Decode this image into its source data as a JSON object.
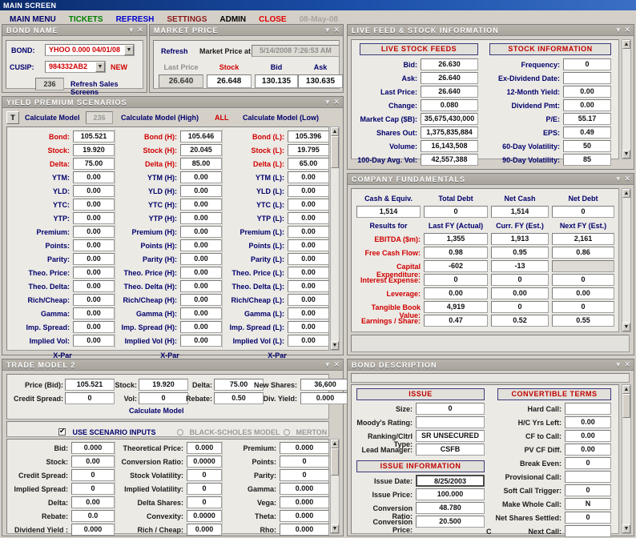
{
  "window": {
    "title": "MAIN SCREEN",
    "minimize": "▾",
    "close": "✕"
  },
  "menubar": {
    "items": [
      {
        "label": "MAIN MENU",
        "color": "#00006b"
      },
      {
        "label": "TICKETS",
        "color": "#008000"
      },
      {
        "label": "REFRESH",
        "color": "#0000cc"
      },
      {
        "label": "SETTINGS",
        "color": "#8b1a1a"
      },
      {
        "label": "ADMIN",
        "color": "#000000"
      },
      {
        "label": "CLOSE",
        "color": "#e00000"
      }
    ],
    "date": "08-May-08"
  },
  "bond_name": {
    "title": "BOND NAME",
    "bond_label": "BOND:",
    "bond_value": "YHOO 0.000 04/01/08",
    "cusip_label": "CUSIP:",
    "cusip_value": "984332AB2",
    "new_button": "NEW",
    "count_button": "236",
    "refresh_sales": "Refresh Sales Screens"
  },
  "market_price": {
    "title": "MARKET PRICE",
    "refresh": "Refresh",
    "at_label": "Market Price at",
    "timestamp": "5/14/2008 7:26:53 AM",
    "columns": [
      {
        "label": "Last Price",
        "value": "26.640",
        "style": "gray"
      },
      {
        "label": "Stock",
        "value": "26.648",
        "style": "red"
      },
      {
        "label": "Bid",
        "value": "130.135",
        "style": "blue"
      },
      {
        "label": "Ask",
        "value": "130.635",
        "style": "blue"
      }
    ]
  },
  "yield_premium": {
    "title": "YIELD PREMIUM SCENARIOS",
    "toolbar": {
      "t_button": "T",
      "calc_model": "Calculate Model",
      "count": "236",
      "calc_high": "Calculate Model (High)",
      "all": "ALL",
      "calc_low": "Calculate Model (Low)"
    },
    "columns": [
      {
        "xpar": "X-Par",
        "rows": [
          {
            "label": "Bond:",
            "value": "105.521",
            "red": true
          },
          {
            "label": "Stock:",
            "value": "19.920",
            "red": true
          },
          {
            "label": "Delta:",
            "value": "75.00",
            "red": true
          },
          {
            "label": "YTM:",
            "value": "0.00",
            "red": false
          },
          {
            "label": "YLD:",
            "value": "0.00",
            "red": false
          },
          {
            "label": "YTC:",
            "value": "0.00",
            "red": false
          },
          {
            "label": "YTP:",
            "value": "0.00",
            "red": false
          },
          {
            "label": "Premium:",
            "value": "0.00",
            "red": false
          },
          {
            "label": "Points:",
            "value": "0.00",
            "red": false
          },
          {
            "label": "Parity:",
            "value": "0.00",
            "red": false
          },
          {
            "label": "Theo. Price:",
            "value": "0.00",
            "red": false
          },
          {
            "label": "Theo. Delta:",
            "value": "0.00",
            "red": false
          },
          {
            "label": "Rich/Cheap:",
            "value": "0.00",
            "red": false
          },
          {
            "label": "Gamma:",
            "value": "0.00",
            "red": false
          },
          {
            "label": "Imp. Spread:",
            "value": "0.00",
            "red": false
          },
          {
            "label": "Implied Vol:",
            "value": "0.00",
            "red": false
          }
        ]
      },
      {
        "xpar": "X-Par",
        "rows": [
          {
            "label": "Bond (H):",
            "value": "105.646",
            "red": true
          },
          {
            "label": "Stock (H):",
            "value": "20.045",
            "red": true
          },
          {
            "label": "Delta (H):",
            "value": "85.00",
            "red": true
          },
          {
            "label": "YTM (H):",
            "value": "0.00",
            "red": false
          },
          {
            "label": "YLD (H):",
            "value": "0.00",
            "red": false
          },
          {
            "label": "YTC (H):",
            "value": "0.00",
            "red": false
          },
          {
            "label": "YTP (H):",
            "value": "0.00",
            "red": false
          },
          {
            "label": "Premium (H):",
            "value": "0.00",
            "red": false
          },
          {
            "label": "Points (H):",
            "value": "0.00",
            "red": false
          },
          {
            "label": "Parity (H):",
            "value": "0.00",
            "red": false
          },
          {
            "label": "Theo. Price (H):",
            "value": "0.00",
            "red": false
          },
          {
            "label": "Theo. Delta (H):",
            "value": "0.00",
            "red": false
          },
          {
            "label": "Rich/Cheap (H):",
            "value": "0.00",
            "red": false
          },
          {
            "label": "Gamma (H):",
            "value": "0.00",
            "red": false
          },
          {
            "label": "Imp. Spread (H):",
            "value": "0.00",
            "red": false
          },
          {
            "label": "Implied Vol (H):",
            "value": "0.00",
            "red": false
          }
        ]
      },
      {
        "xpar": "X-Par",
        "rows": [
          {
            "label": "Bond (L):",
            "value": "105.396",
            "red": true
          },
          {
            "label": "Stock (L):",
            "value": "19.795",
            "red": true
          },
          {
            "label": "Delta (L):",
            "value": "65.00",
            "red": true
          },
          {
            "label": "YTM (L):",
            "value": "0.00",
            "red": false
          },
          {
            "label": "YLD (L):",
            "value": "0.00",
            "red": false
          },
          {
            "label": "YTC (L):",
            "value": "0.00",
            "red": false
          },
          {
            "label": "YTP (L):",
            "value": "0.00",
            "red": false
          },
          {
            "label": "Premium (L):",
            "value": "0.00",
            "red": false
          },
          {
            "label": "Points (L):",
            "value": "0.00",
            "red": false
          },
          {
            "label": "Parity (L):",
            "value": "0.00",
            "red": false
          },
          {
            "label": "Theo. Price (L):",
            "value": "0.00",
            "red": false
          },
          {
            "label": "Theo. Delta (L):",
            "value": "0.00",
            "red": false
          },
          {
            "label": "Rich/Cheap (L):",
            "value": "0.00",
            "red": false
          },
          {
            "label": "Gamma (L):",
            "value": "0.00",
            "red": false
          },
          {
            "label": "Imp. Spread (L):",
            "value": "0.00",
            "red": false
          },
          {
            "label": "Implied Vol (L):",
            "value": "0.00",
            "red": false
          }
        ]
      }
    ]
  },
  "trade_model": {
    "title": "TRADE MODEL 2",
    "inputs_row1": [
      {
        "label": "Price (Bid):",
        "value": "105.521"
      },
      {
        "label": "Stock:",
        "value": "19.920"
      },
      {
        "label": "Delta:",
        "value": "75.00"
      },
      {
        "label": "New Shares:",
        "value": "36,600"
      }
    ],
    "inputs_row2": [
      {
        "label": "Credit Spread:",
        "value": "0"
      },
      {
        "label": "Vol:",
        "value": "0"
      },
      {
        "label": "Rebate:",
        "value": "0.50"
      },
      {
        "label": "Div. Yield:",
        "value": "0.000"
      }
    ],
    "calculate": "Calculate Model",
    "use_scenario_inputs": "USE SCENARIO INPUTS",
    "black_scholes": "BLACK-SCHOLES MODEL",
    "merton": "MERTON MODEL",
    "results": [
      {
        "rows": [
          {
            "label": "Bid:",
            "value": "0.000"
          },
          {
            "label": "Stock:",
            "value": "0.00"
          },
          {
            "label": "Credit Spread:",
            "value": "0"
          },
          {
            "label": "Implied Spread:",
            "value": "0"
          },
          {
            "label": "Delta:",
            "value": "0.00"
          },
          {
            "label": "Rebate:",
            "value": "0.0"
          },
          {
            "label": "Dividend Yield :",
            "value": "0.000"
          }
        ]
      },
      {
        "rows": [
          {
            "label": "Theoretical Price:",
            "value": "0.000"
          },
          {
            "label": "Conversion Ratio:",
            "value": "0.0000"
          },
          {
            "label": "Stock Volatility:",
            "value": "0"
          },
          {
            "label": "Implied Volatility:",
            "value": "0"
          },
          {
            "label": "Delta Shares:",
            "value": "0"
          },
          {
            "label": "Convexity:",
            "value": "0.0000"
          },
          {
            "label": "Rich / Cheap:",
            "value": "0.000"
          }
        ]
      },
      {
        "rows": [
          {
            "label": "Premium:",
            "value": "0.000"
          },
          {
            "label": "Points:",
            "value": "0"
          },
          {
            "label": "Parity:",
            "value": "0"
          },
          {
            "label": "Gamma:",
            "value": "0.000"
          },
          {
            "label": "Vega:",
            "value": "0.000"
          },
          {
            "label": "Theta:",
            "value": "0.000"
          },
          {
            "label": "Rho:",
            "value": "0.000"
          }
        ]
      }
    ]
  },
  "live_feed": {
    "title": "LIVE FEED & STOCK INFORMATION",
    "left_header": "LIVE STOCK FEEDS",
    "right_header": "STOCK INFORMATION",
    "left_rows": [
      {
        "label": "Bid:",
        "value": "26.630"
      },
      {
        "label": "Ask:",
        "value": "26.640"
      },
      {
        "label": "Last Price:",
        "value": "26.640"
      },
      {
        "label": "Change:",
        "value": "0.080"
      },
      {
        "label": "Market Cap ($B):",
        "value": "35,675,430,000"
      },
      {
        "label": "Shares Out:",
        "value": "1,375,835,884"
      },
      {
        "label": "Volume:",
        "value": "16,143,508"
      },
      {
        "label": "100-Day Avg. Vol:",
        "value": "42,557,388"
      }
    ],
    "right_rows": [
      {
        "label": "Frequency:",
        "value": "0"
      },
      {
        "label": "Ex-Dividend Date:",
        "value": ""
      },
      {
        "label": "12-Month Yield:",
        "value": "0.00"
      },
      {
        "label": "Dividend Pmt:",
        "value": "0.00"
      },
      {
        "label": "P/E:",
        "value": "55.17"
      },
      {
        "label": "EPS:",
        "value": "0.49"
      },
      {
        "label": "60-Day Volatility:",
        "value": "50"
      },
      {
        "label": "90-Day Volatility:",
        "value": "85"
      }
    ]
  },
  "fundamentals": {
    "title": "COMPANY FUNDAMENTALS",
    "cash_headers": [
      "Cash & Equiv.",
      "Total Debt",
      "Net Cash",
      "Net Debt"
    ],
    "cash_values": [
      "1,514",
      "0",
      "1,514",
      "0"
    ],
    "results_label": "Results for",
    "period_headers": [
      "Last FY (Actual)",
      "Curr. FY (Est.)",
      "Next FY (Est.)"
    ],
    "rows": [
      {
        "label": "EBITDA ($m):",
        "red": true,
        "values": [
          "1,355",
          "1,913",
          "2,161"
        ]
      },
      {
        "label": "Free Cash Flow:",
        "red": true,
        "values": [
          "0.98",
          "0.95",
          "0.86"
        ]
      },
      {
        "label": "Capital Expenditure:",
        "red": true,
        "values": [
          "-602",
          "-13",
          ""
        ]
      },
      {
        "label": "Interest Expense:",
        "red": true,
        "values": [
          "0",
          "0",
          "0"
        ]
      },
      {
        "label": "Leverage:",
        "red": true,
        "values": [
          "0.00",
          "0.00",
          "0.00"
        ]
      },
      {
        "label": "Tangible Book Value:",
        "red": true,
        "values": [
          "4,919",
          "0",
          "0"
        ]
      },
      {
        "label": "Earnings / Share:",
        "red": true,
        "values": [
          "0.47",
          "0.52",
          "0.55"
        ]
      }
    ]
  },
  "bond_description": {
    "title": "BOND DESCRIPTION",
    "issue_header": "ISSUE",
    "convertible_header": "CONVERTIBLE TERMS",
    "issue_info_header": "ISSUE INFORMATION",
    "issue_rows": [
      {
        "label": "Size:",
        "value": "0"
      },
      {
        "label": "Moody's Rating:",
        "value": ""
      },
      {
        "label": "Ranking/Cltrl Type:",
        "value": "SR UNSECURED"
      },
      {
        "label": "Lead Manager:",
        "value": "CSFB"
      }
    ],
    "issue_info_rows": [
      {
        "label": "Issue Date:",
        "value": "8/25/2003"
      },
      {
        "label": "Issue Price:",
        "value": "100.000"
      },
      {
        "label": "Conversion Ratio:",
        "value": "48.780"
      },
      {
        "label": "Conversion Price:",
        "value": "20.500"
      }
    ],
    "convertible_rows": [
      {
        "label": "Hard Call:",
        "value": ""
      },
      {
        "label": "H/C Yrs Left:",
        "value": "0.00"
      },
      {
        "label": "CF to Call:",
        "value": "0.00"
      },
      {
        "label": "PV CF Diff.",
        "value": "0.00"
      },
      {
        "label": "Break Even:",
        "value": "0"
      },
      {
        "label": "Provisional Call:",
        "value": ""
      },
      {
        "label": "Soft Call Trigger:",
        "value": "0"
      },
      {
        "label": "Make Whole Call:",
        "value": "N"
      },
      {
        "label": "Net Shares Settled:",
        "value": "0"
      },
      {
        "label": "Next Call:",
        "value": "",
        "prefix": "C"
      }
    ]
  }
}
